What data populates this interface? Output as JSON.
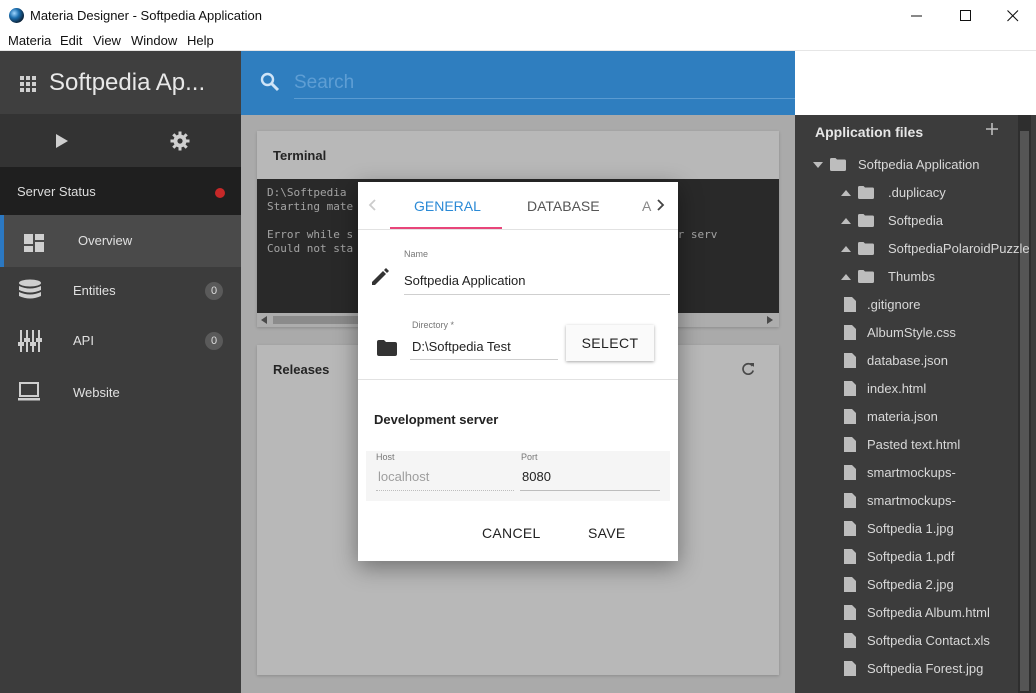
{
  "window": {
    "title": "Materia Designer - Softpedia Application",
    "icons": {
      "app": "materia-logo-icon",
      "minimize": "minimize-icon",
      "maximize": "maximize-icon",
      "close": "close-icon"
    }
  },
  "menu": [
    "Materia",
    "Edit",
    "View",
    "Window",
    "Help"
  ],
  "sidebar": {
    "app_name": "Softpedia Ap...",
    "tools": {
      "run": "play-icon",
      "settings": "gear-icon"
    },
    "server_status": {
      "label": "Server Status",
      "state_color": "#c62828"
    },
    "nav": [
      {
        "label": "Overview",
        "icon": "dashboard-icon",
        "active": true
      },
      {
        "label": "Entities",
        "icon": "database-icon",
        "badge": "0"
      },
      {
        "label": "API",
        "icon": "api-sliders-icon",
        "badge": "0"
      },
      {
        "label": "Website",
        "icon": "monitor-icon"
      }
    ]
  },
  "search": {
    "placeholder": "Search",
    "value": ""
  },
  "terminal": {
    "title": "Terminal",
    "lines": [
      "D:\\Softpedia",
      "Starting mate",
      "",
      "Error while s                                        by another serv",
      "Could not sta"
    ]
  },
  "releases": {
    "title": "Releases"
  },
  "files": {
    "title": "Application files",
    "items": [
      {
        "label": "Softpedia Application",
        "type": "folder",
        "expanded": true,
        "depth": 0
      },
      {
        "label": ".duplicacy",
        "type": "folder",
        "depth": 1
      },
      {
        "label": "Softpedia",
        "type": "folder",
        "depth": 1
      },
      {
        "label": "SoftpediaPolaroidPuzzle",
        "type": "folder",
        "depth": 1
      },
      {
        "label": "Thumbs",
        "type": "folder",
        "depth": 1
      },
      {
        "label": ".gitignore",
        "type": "file",
        "depth": 1
      },
      {
        "label": "AlbumStyle.css",
        "type": "file",
        "depth": 1
      },
      {
        "label": "database.json",
        "type": "file",
        "depth": 1
      },
      {
        "label": "index.html",
        "type": "file",
        "depth": 1
      },
      {
        "label": "materia.json",
        "type": "file",
        "depth": 1
      },
      {
        "label": "Pasted text.html",
        "type": "file",
        "depth": 1
      },
      {
        "label": "smartmockups-",
        "type": "file",
        "depth": 1
      },
      {
        "label": "smartmockups-",
        "type": "file",
        "depth": 1
      },
      {
        "label": "Softpedia 1.jpg",
        "type": "file",
        "depth": 1
      },
      {
        "label": "Softpedia 1.pdf",
        "type": "file",
        "depth": 1
      },
      {
        "label": "Softpedia 2.jpg",
        "type": "file",
        "depth": 1
      },
      {
        "label": "Softpedia Album.html",
        "type": "file",
        "depth": 1
      },
      {
        "label": "Softpedia Contact.xls",
        "type": "file",
        "depth": 1
      },
      {
        "label": "Softpedia Forest.jpg",
        "type": "file",
        "depth": 1
      }
    ]
  },
  "dialog": {
    "tabs": [
      "GENERAL",
      "DATABASE"
    ],
    "active_tab": "GENERAL",
    "tab_overflow": "A",
    "name": {
      "label": "Name",
      "value": "Softpedia Application"
    },
    "directory": {
      "label": "Directory *",
      "value": "D:\\Softpedia Test",
      "button": "SELECT"
    },
    "dev_server": {
      "title": "Development server",
      "host": {
        "label": "Host",
        "placeholder": "localhost"
      },
      "port": {
        "label": "Port",
        "value": "8080"
      }
    },
    "actions": {
      "cancel": "CANCEL",
      "save": "SAVE"
    }
  },
  "colors": {
    "accent": "#2f7ebf",
    "tab_ink": "#e8457a",
    "sidebar": "#3c3c3c"
  }
}
